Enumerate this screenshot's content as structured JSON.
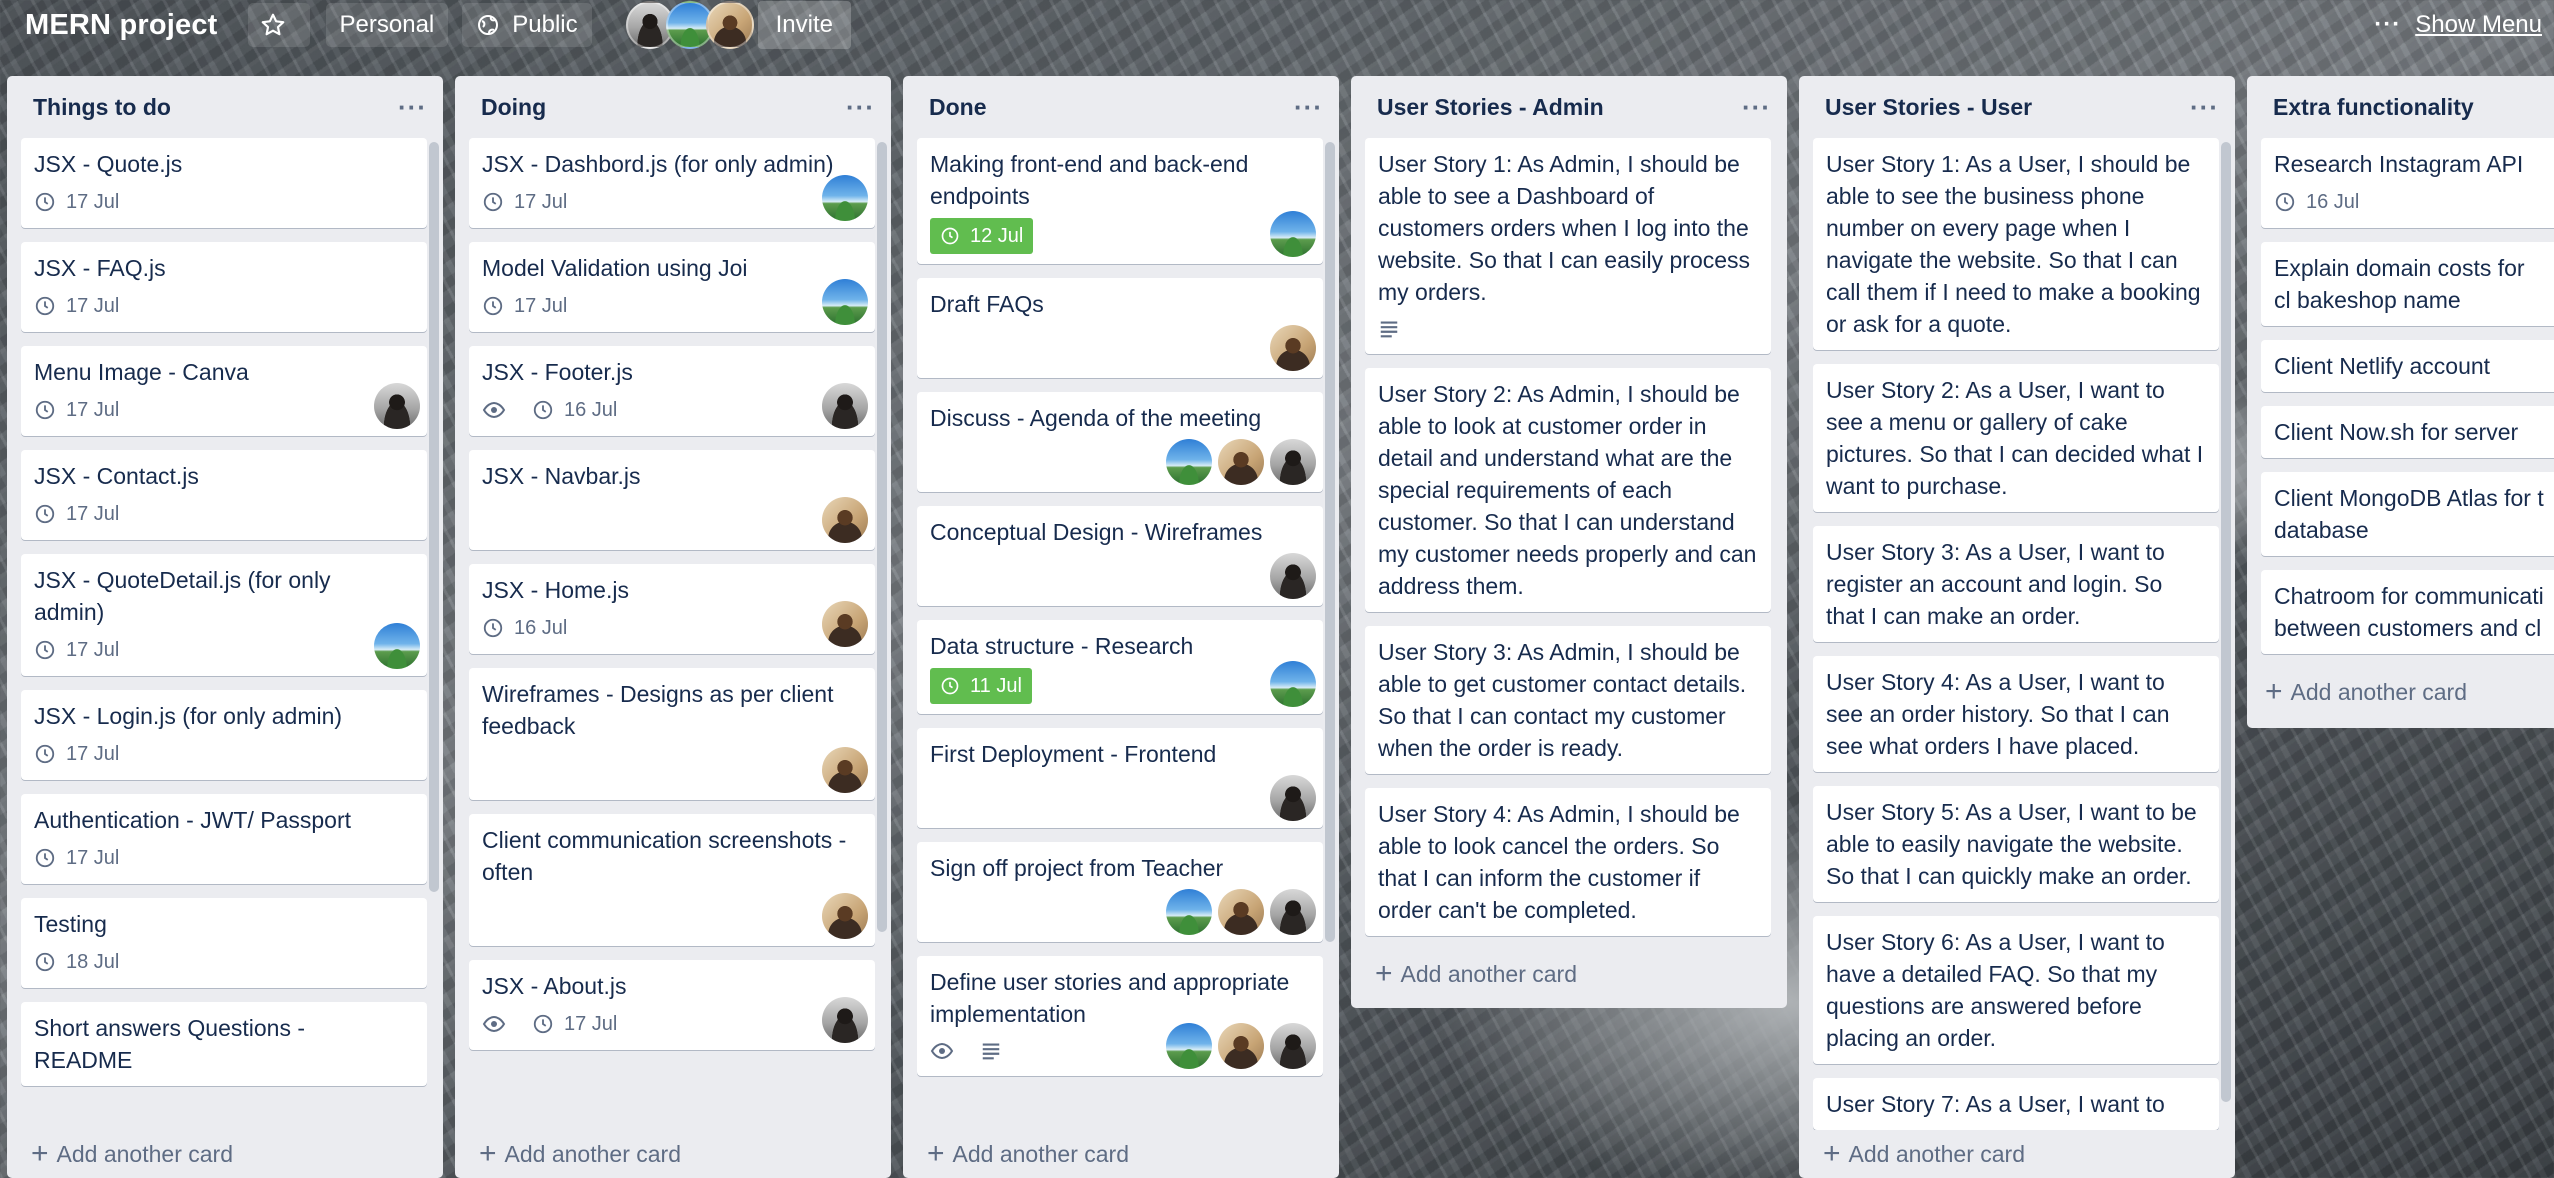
{
  "board": {
    "title": "MERN project",
    "team": "Personal",
    "visibility": "Public",
    "invite_label": "Invite",
    "show_menu_label": "Show Menu",
    "more_label": "···"
  },
  "add_card_label": "Add another card",
  "lists": [
    {
      "title": "Things to do",
      "cards": [
        {
          "title": "JSX - Quote.js",
          "date": "17 Jul"
        },
        {
          "title": "JSX - FAQ.js",
          "date": "17 Jul"
        },
        {
          "title": "Menu Image - Canva",
          "date": "17 Jul",
          "members": [
            "dark"
          ]
        },
        {
          "title": "JSX - Contact.js",
          "date": "17 Jul"
        },
        {
          "title": "JSX - QuoteDetail.js (for only admin)",
          "date": "17 Jul",
          "members": [
            "sky"
          ]
        },
        {
          "title": "JSX - Login.js (for only admin)",
          "date": "17 Jul"
        },
        {
          "title": "Authentication - JWT/ Passport",
          "date": "17 Jul"
        },
        {
          "title": "Testing",
          "date": "18 Jul"
        },
        {
          "title": "Short answers Questions - README"
        }
      ]
    },
    {
      "title": "Doing",
      "cards": [
        {
          "title": "JSX - Dashbord.js (for only admin)",
          "date": "17 Jul",
          "members": [
            "sky"
          ]
        },
        {
          "title": "Model Validation using Joi",
          "date": "17 Jul",
          "members": [
            "sky"
          ]
        },
        {
          "title": "JSX - Footer.js",
          "watch": true,
          "date": "16 Jul",
          "members": [
            "dark"
          ]
        },
        {
          "title": "JSX - Navbar.js",
          "members": [
            "tan"
          ]
        },
        {
          "title": "JSX - Home.js",
          "date": "16 Jul",
          "members": [
            "tan"
          ]
        },
        {
          "title": "Wireframes - Designs as per client feedback",
          "members": [
            "tan"
          ]
        },
        {
          "title": "Client communication screenshots - often",
          "members": [
            "tan"
          ]
        },
        {
          "title": "JSX - About.js",
          "watch": true,
          "date": "17 Jul",
          "members": [
            "dark"
          ]
        }
      ]
    },
    {
      "title": "Done",
      "cards": [
        {
          "title": "Making front-end and back-end endpoints",
          "date": "12 Jul",
          "date_complete": true,
          "members": [
            "sky"
          ]
        },
        {
          "title": "Draft FAQs",
          "members": [
            "tan"
          ]
        },
        {
          "title": "Discuss - Agenda of the meeting",
          "members": [
            "sky",
            "tan",
            "dark"
          ]
        },
        {
          "title": "Conceptual Design - Wireframes",
          "members": [
            "dark"
          ]
        },
        {
          "title": "Data structure - Research",
          "date": "11 Jul",
          "date_complete": true,
          "members": [
            "sky"
          ]
        },
        {
          "title": "First Deployment - Frontend",
          "members": [
            "dark"
          ]
        },
        {
          "title": "Sign off project from Teacher",
          "members": [
            "sky",
            "tan",
            "dark"
          ]
        },
        {
          "title": "Define user stories and appropriate implementation",
          "watch": true,
          "description": true,
          "members": [
            "sky",
            "tan",
            "dark"
          ]
        }
      ]
    },
    {
      "title": "User Stories - Admin",
      "cards": [
        {
          "title": "User Story 1: As Admin, I should be able to see a Dashboard of customers orders when I log into the website. So that I can easily process my orders.",
          "description": true
        },
        {
          "title": "User Story 2: As Admin, I should be able to look at customer order in detail and understand what are the special requirements of each customer. So that I can understand my customer needs properly and can address them."
        },
        {
          "title": "User Story 3: As Admin, I should be able to get customer contact details. So that I can contact my customer when the order is ready."
        },
        {
          "title": "User Story 4: As Admin, I should be able to look cancel the orders. So that I can inform the customer if order can't be completed."
        }
      ]
    },
    {
      "title": "User Stories - User",
      "cards": [
        {
          "title": "User Story 1: As a User, I should be able to see the business phone number on every page when I navigate the website. So that I can call them if I need to make a booking or ask for a quote."
        },
        {
          "title": "User Story 2: As a User, I want to see a menu or gallery of cake pictures. So that I can decided what I want to purchase."
        },
        {
          "title": "User Story 3: As a User, I want to register an account and login. So that I can make an order."
        },
        {
          "title": "User Story 4: As a User, I want to see an order history. So that I can see what orders I have placed."
        },
        {
          "title": "User Story 5: As a User, I want to be able to easily navigate the website. So that I can quickly make an order."
        },
        {
          "title": "User Story 6: As a User, I want to have a detailed FAQ. So that my questions are answered before placing an order."
        },
        {
          "title": "User Story 7: As a User, I want to"
        }
      ]
    },
    {
      "title": "Extra functionality",
      "cards": [
        {
          "title": "Research Instagram API",
          "date": "16 Jul"
        },
        {
          "title": "Explain domain costs for cl bakeshop name"
        },
        {
          "title": "Client Netlify account"
        },
        {
          "title": "Client Now.sh for server"
        },
        {
          "title": "Client MongoDB Atlas for t database"
        },
        {
          "title": "Chatroom for communicati between customers and cl"
        }
      ]
    }
  ]
}
